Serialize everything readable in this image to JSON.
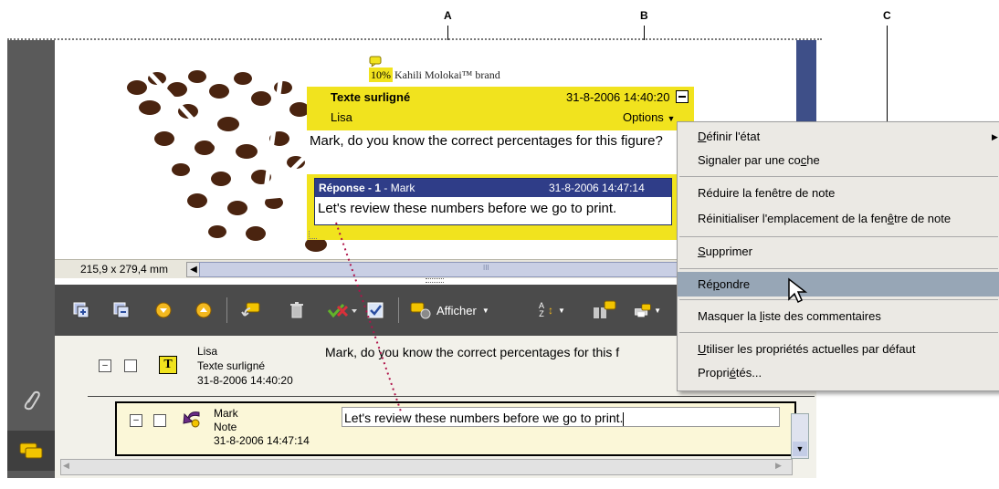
{
  "callouts": [
    "A",
    "B",
    "C"
  ],
  "document": {
    "brand_text": "Kahili Molokai™ brand",
    "percent_label": "10%",
    "page_size": "215,9 x 279,4 mm",
    "scroll_grip": "III"
  },
  "note_popup": {
    "title": "Texte surligné",
    "timestamp": "31-8-2006 14:40:20",
    "author": "Lisa",
    "options_label": "Options",
    "body": "Mark, do you know the correct percentages for this figure?",
    "reply": {
      "label": "Réponse",
      "number": "1",
      "author": "Mark",
      "timestamp": "31-8-2006 14:47:14",
      "body": "Let's review these numbers before we go to print."
    }
  },
  "toolbar": {
    "show_label": "Afficher",
    "sort_label": "A Z"
  },
  "comments": [
    {
      "author": "Lisa",
      "type": "Texte surligné",
      "date": "31-8-2006 14:40:20",
      "text": "Mark, do you know the correct percentages for this f",
      "icon": "T"
    },
    {
      "author": "Mark",
      "type": "Note",
      "date": "31-8-2006 14:47:14",
      "text": "Let's review these numbers before we go to print."
    }
  ],
  "context_menu": {
    "items": [
      {
        "pre": "",
        "acc": "D",
        "post": "éfinir l'état"
      },
      {
        "pre": "Signaler par une co",
        "acc": "c",
        "post": "he"
      },
      {
        "pre": "Réduire la fenêtre de note",
        "acc": "",
        "post": ""
      },
      {
        "pre": "Réinitialiser l'emplacement de la fen",
        "acc": "ê",
        "post": "tre de note"
      },
      {
        "pre": "",
        "acc": "S",
        "post": "upprimer"
      },
      {
        "pre": "Ré",
        "acc": "p",
        "post": "ondre"
      },
      {
        "pre": "Masquer la ",
        "acc": "l",
        "post": "iste des commentaires"
      },
      {
        "pre": "",
        "acc": "U",
        "post": "tiliser les propriétés actuelles par défaut"
      },
      {
        "pre": "Propri",
        "acc": "é",
        "post": "tés..."
      }
    ],
    "highlighted": "Répondre"
  },
  "colors": {
    "note_yellow": "#f1e31e",
    "reply_header": "#2f3d88",
    "menu_highlight": "#97a6b6",
    "panel_dark": "#4b4b4b"
  }
}
